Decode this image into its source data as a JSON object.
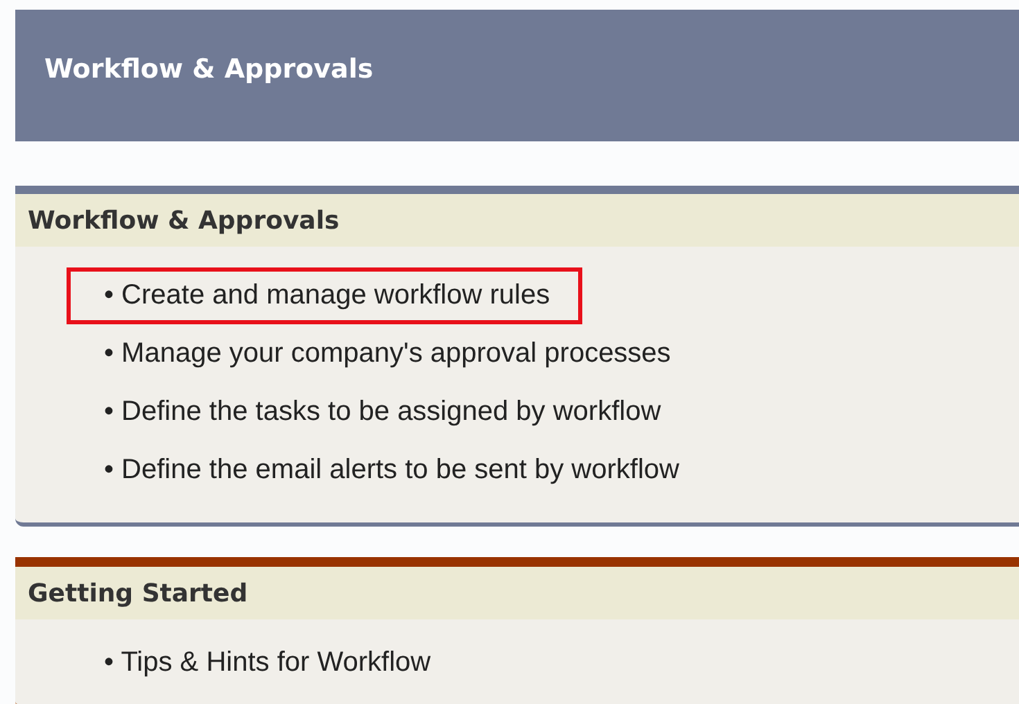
{
  "page_header": {
    "title": "Workflow & Approvals"
  },
  "sections": [
    {
      "title": "Workflow & Approvals",
      "kind": "main",
      "items": [
        {
          "label": "• Create and manage workflow rules",
          "highlighted": true
        },
        {
          "label": "• Manage your company's approval processes",
          "highlighted": false
        },
        {
          "label": "• Define the tasks to be assigned by workflow",
          "highlighted": false
        },
        {
          "label": "• Define the email alerts to be sent by workflow",
          "highlighted": false
        }
      ]
    },
    {
      "title": "Getting Started",
      "kind": "help",
      "items": [
        {
          "label": "• Tips & Hints for Workflow",
          "highlighted": false
        }
      ]
    }
  ]
}
